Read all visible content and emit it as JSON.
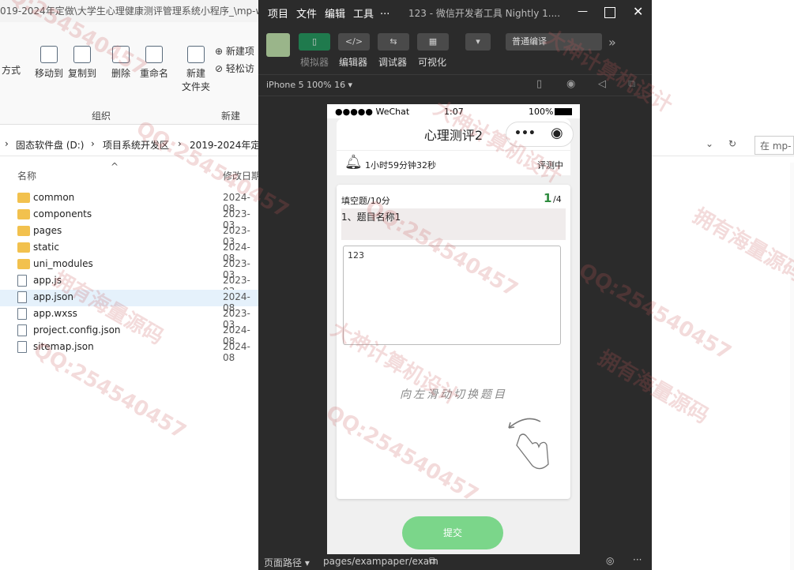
{
  "explorer": {
    "title": "019-2024年定做\\大学生心理健康测评管理系统小程序_\\mp-w",
    "ribbon": {
      "cut_partial": "方式",
      "move_to": "移动到",
      "copy_to": "复制到",
      "delete": "删除",
      "rename": "重命名",
      "new_folder_line1": "新建",
      "new_folder_line2": "文件夹",
      "new_item": "新建项",
      "easy_access": "轻松访",
      "group_organize": "组织",
      "group_new": "新建"
    },
    "breadcrumb": [
      "固态软件盘 (D:)",
      "项目系统开发区",
      "2019-2024年定"
    ],
    "search_placeholder": "在 mp-",
    "columns": {
      "name": "名称",
      "date": "修改日期"
    },
    "files": [
      {
        "name": "common",
        "date": "2024-08",
        "type": "folder"
      },
      {
        "name": "components",
        "date": "2023-03",
        "type": "folder"
      },
      {
        "name": "pages",
        "date": "2023-03",
        "type": "folder"
      },
      {
        "name": "static",
        "date": "2024-08",
        "type": "folder"
      },
      {
        "name": "uni_modules",
        "date": "2023-03",
        "type": "folder"
      },
      {
        "name": "app.js",
        "date": "2023-03",
        "type": "file"
      },
      {
        "name": "app.json",
        "date": "2024-08",
        "type": "file"
      },
      {
        "name": "app.wxss",
        "date": "2023-03",
        "type": "file"
      },
      {
        "name": "project.config.json",
        "date": "2024-08",
        "type": "file"
      },
      {
        "name": "sitemap.json",
        "date": "2024-08",
        "type": "file"
      }
    ]
  },
  "devtools": {
    "menu": [
      "项目",
      "文件",
      "编辑",
      "工具",
      "..."
    ],
    "title": "123 - 微信开发者工具 Nightly 1....",
    "toolbar": {
      "simulator": "模拟器",
      "editor": "编辑器",
      "debugger": "调试器",
      "visual": "可视化",
      "compile_mode": "普通编译"
    },
    "device": "iPhone 5 100% 16 ▾",
    "bottom": {
      "path_label": "页面路径 ▾",
      "path": "pages/exampaper/exam"
    }
  },
  "phone": {
    "status": {
      "carrier": "●●●●● WeChat",
      "time": "1:07",
      "battery": "100%"
    },
    "nav_title": "心理测评2",
    "timer": "1小时59分钟32秒",
    "status_label": "评测中",
    "question_type": "填空题/10分",
    "progress_current": "1",
    "progress_total": "/4",
    "question_title": "1、题目名称1",
    "answer_text": "123",
    "swipe_hint": "向左滑动切换题目",
    "submit_label": "提交"
  },
  "watermark": {
    "qq": "QQ:254540457",
    "line1": "拥有海量源码",
    "line2": "大神计算机设计"
  }
}
